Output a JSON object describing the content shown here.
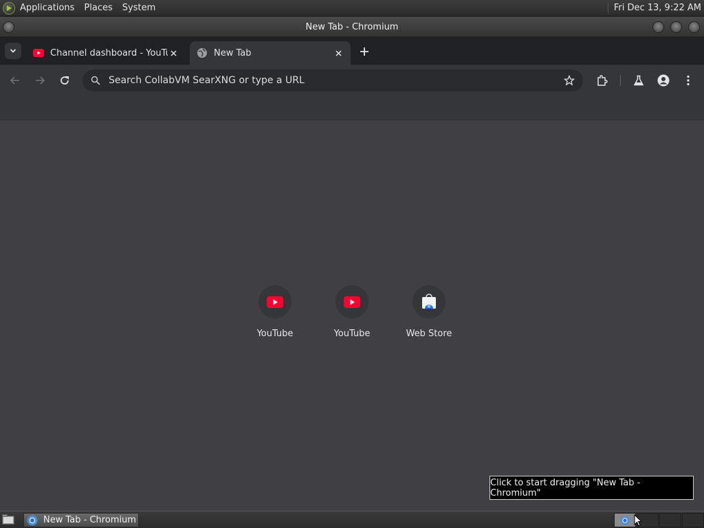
{
  "top_panel": {
    "menus": [
      "Applications",
      "Places",
      "System"
    ],
    "clock": "Fri Dec 13,  9:22 AM"
  },
  "window": {
    "title": "New Tab - Chromium"
  },
  "tabs": [
    {
      "title": "Channel dashboard - YouTube",
      "favicon": "youtube-icon",
      "active": false
    },
    {
      "title": "New Tab",
      "favicon": "globe-icon",
      "active": true
    }
  ],
  "omnibox": {
    "placeholder": "Search CollabVM SearXNG or type a URL"
  },
  "shortcuts": [
    {
      "label": "YouTube",
      "icon": "youtube-icon"
    },
    {
      "label": "YouTube",
      "icon": "youtube-icon"
    },
    {
      "label": "Web Store",
      "icon": "web-store-icon"
    }
  ],
  "tooltip": {
    "text": "Click to start dragging \"New Tab - Chromium\""
  },
  "taskbar": {
    "task_label": "New Tab - Chromium"
  },
  "colors": {
    "youtube_red": "#ff0033",
    "content_bg": "#3f3f44",
    "toolbar_bg": "#35363a",
    "tabstrip_bg": "#202124"
  }
}
